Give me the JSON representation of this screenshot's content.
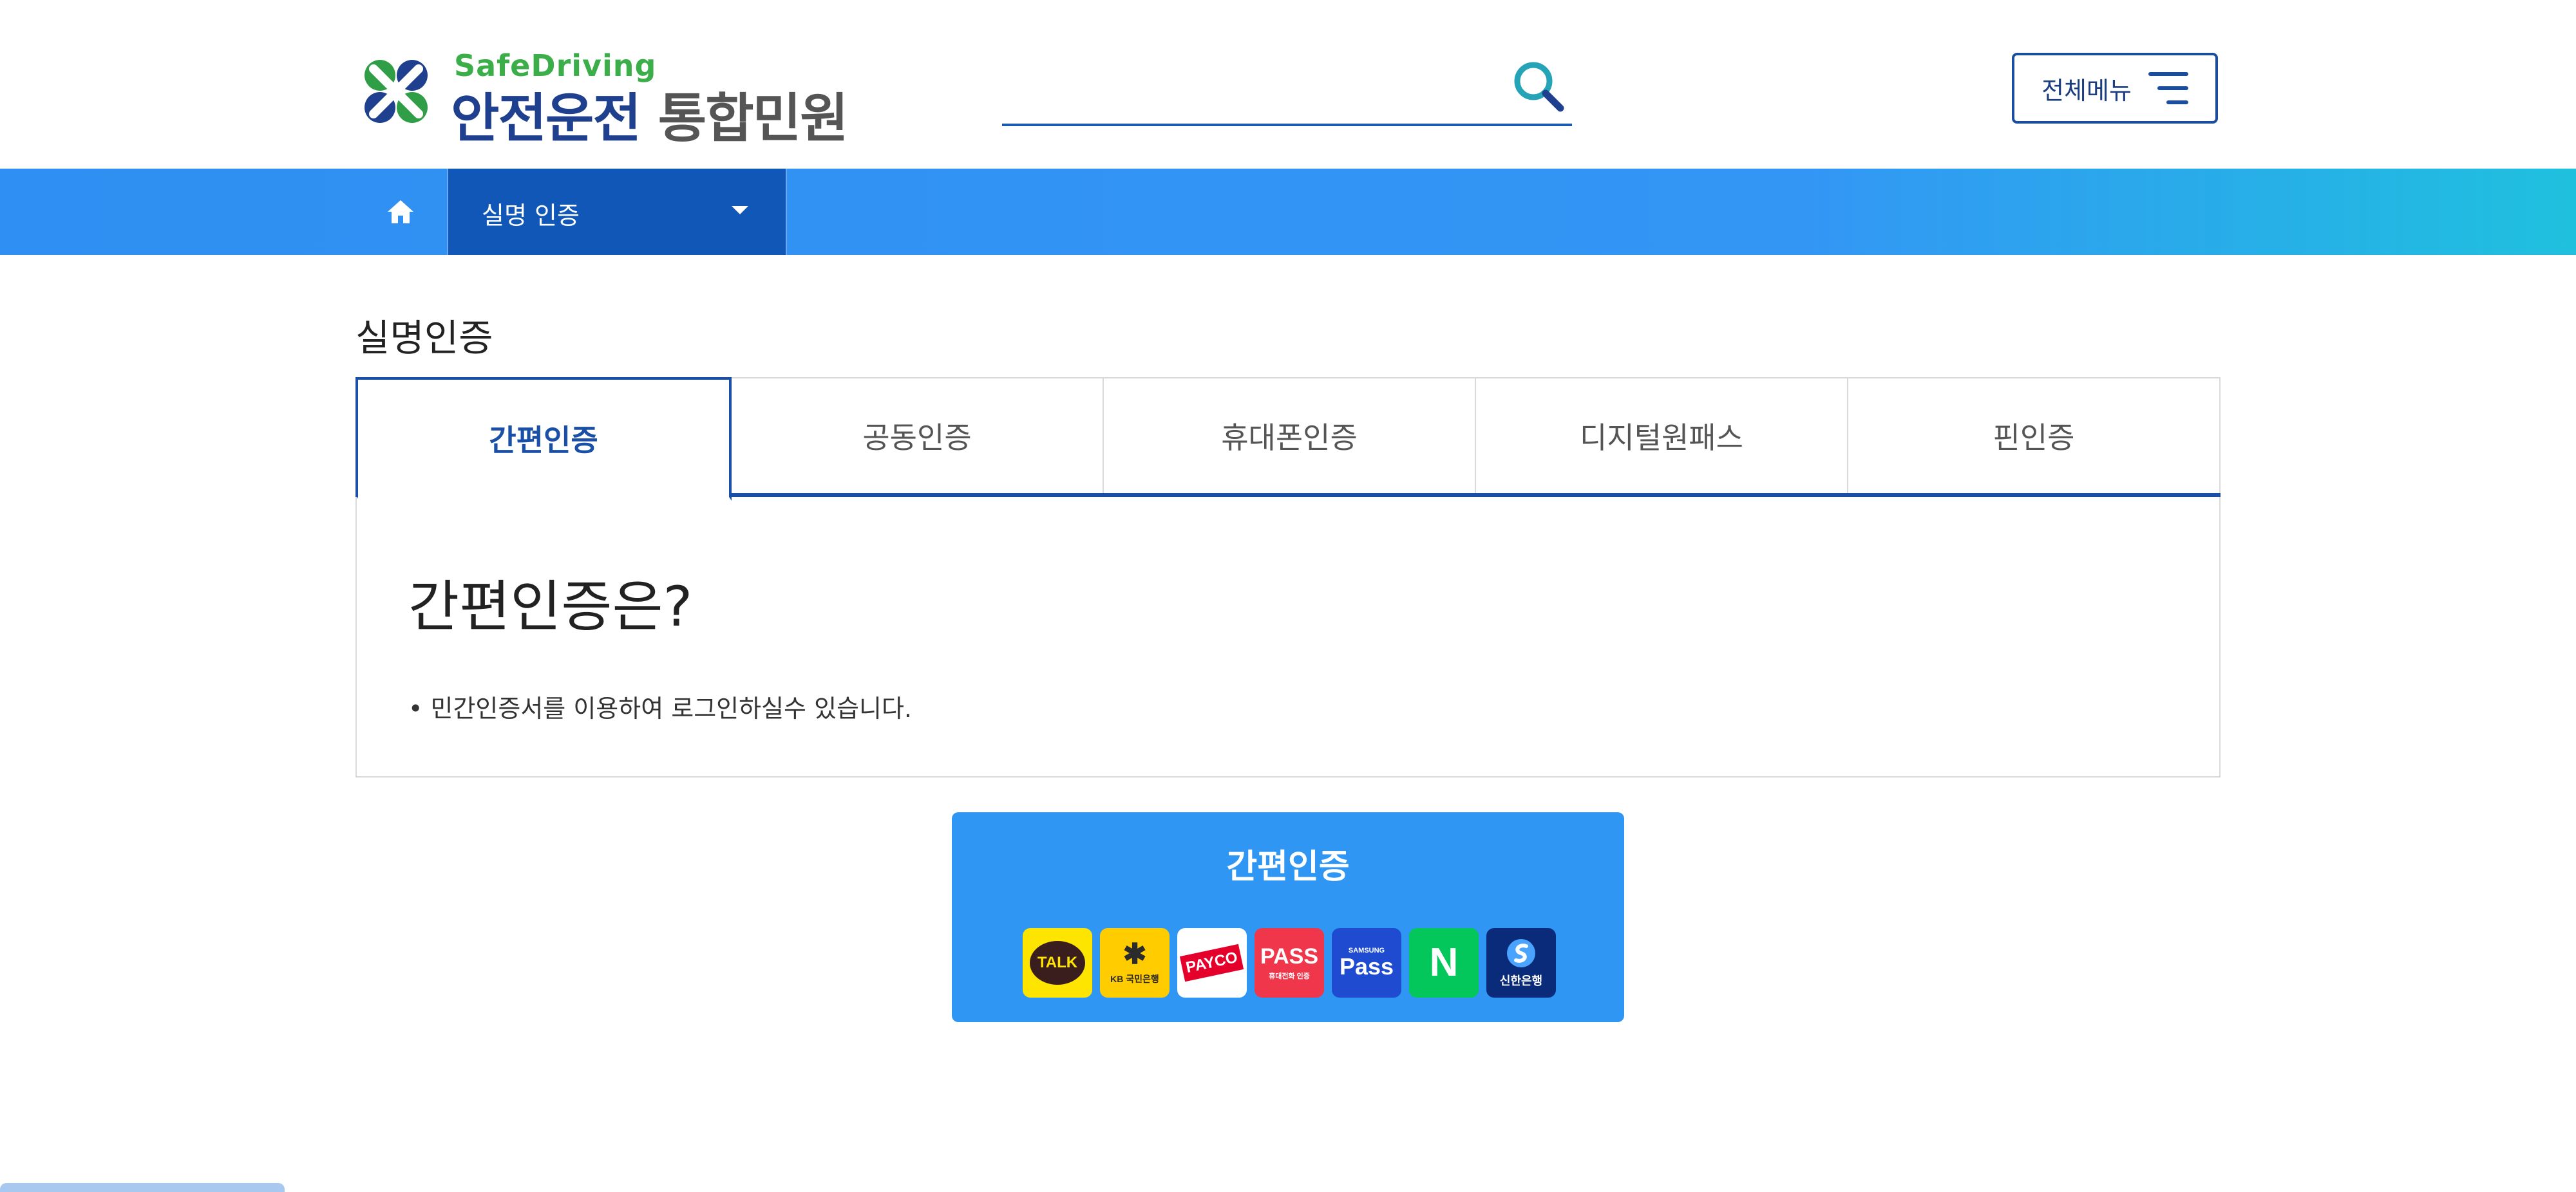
{
  "header": {
    "logo_sub": "SafeDriving",
    "logo_main": "안전운전",
    "logo_service": "통합민원",
    "search_placeholder": "",
    "menu_label": "전체메뉴"
  },
  "nav": {
    "current": "실명 인증"
  },
  "page": {
    "title": "실명인증"
  },
  "tabs": [
    {
      "label": "간편인증",
      "active": true
    },
    {
      "label": "공동인증",
      "active": false
    },
    {
      "label": "휴대폰인증",
      "active": false
    },
    {
      "label": "디지털원패스",
      "active": false
    },
    {
      "label": "핀인증",
      "active": false
    }
  ],
  "content": {
    "heading": "간편인증은?",
    "bullet": "• 민간인증서를 이용하여 로그인하실수 있습니다."
  },
  "auth_button": {
    "label": "간편인증",
    "providers": [
      {
        "name": "kakao",
        "text": "TALK",
        "bg": "#fee500",
        "fg": "#3a1d1d"
      },
      {
        "name": "kb",
        "text": "KB 국민은행",
        "bg": "#ffcc00",
        "fg": "#2b2b2b"
      },
      {
        "name": "payco",
        "text": "PAYCO",
        "bg": "#ffffff",
        "fg": "#e4002b"
      },
      {
        "name": "pass",
        "text": "PASS",
        "sub": "휴대전화 인증",
        "bg": "#f0364b",
        "fg": "#ffffff"
      },
      {
        "name": "samsung-pass",
        "text": "Pass",
        "sub": "SAMSUNG",
        "bg": "#1f4bd1",
        "fg": "#ffffff"
      },
      {
        "name": "naver",
        "text": "N",
        "bg": "#03c75a",
        "fg": "#ffffff"
      },
      {
        "name": "shinhan",
        "text": "신한은행",
        "bg": "#0a2a7a",
        "fg": "#ffffff"
      }
    ]
  },
  "colors": {
    "primary": "#1a4fa8",
    "nav_blue": "#2f8ff2",
    "nav_active": "#1157b8",
    "auth_blue": "#3096f3",
    "logo_green": "#3bae49"
  }
}
